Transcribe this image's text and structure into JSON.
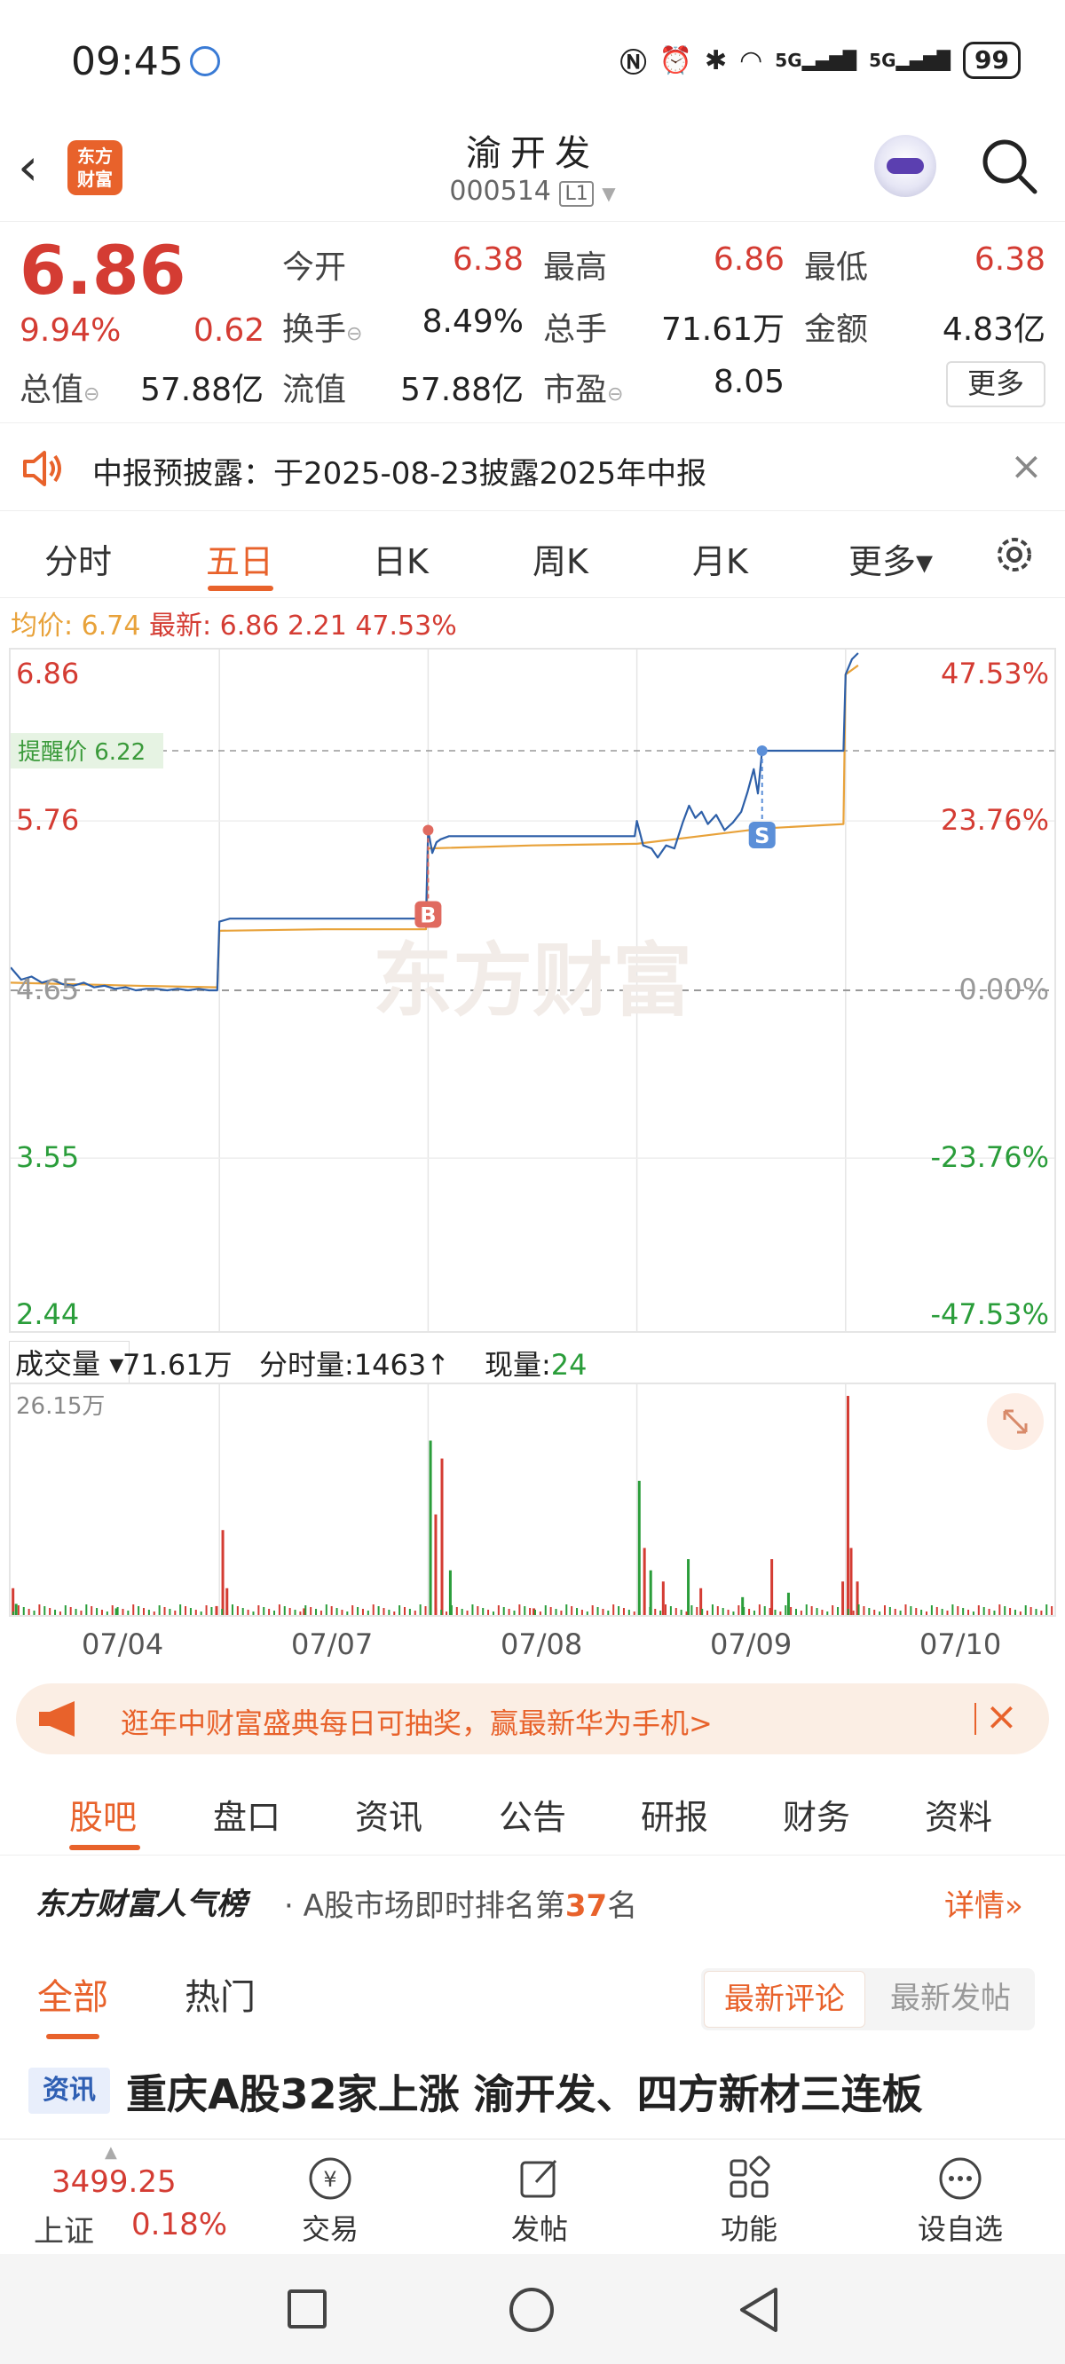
{
  "status_bar": {
    "time": "09:45",
    "network_1": "5G",
    "network_2": "5G",
    "battery": "99"
  },
  "header": {
    "stock_name": "渝开发",
    "stock_code": "000514",
    "level": "L1",
    "logo_line1": "东方",
    "logo_line2": "财富"
  },
  "quote": {
    "price": "6.86",
    "change_pct": "9.94%",
    "change": "0.62",
    "items": [
      {
        "label": "今开",
        "value": "6.38",
        "color": "#d43c33"
      },
      {
        "label": "最高",
        "value": "6.86",
        "color": "#d43c33"
      },
      {
        "label": "最低",
        "value": "6.38",
        "color": "#d43c33"
      },
      {
        "label": "换手",
        "value": "8.49%",
        "color": "#222222"
      },
      {
        "label": "总手",
        "value": "71.61万",
        "color": "#222222"
      },
      {
        "label": "金额",
        "value": "4.83亿",
        "color": "#222222"
      },
      {
        "label": "流值",
        "value": "57.88亿",
        "color": "#222222"
      },
      {
        "label": "市盈",
        "value": "8.05",
        "color": "#222222"
      }
    ],
    "total_value_label": "总值",
    "total_value": "57.88亿",
    "more_label": "更多"
  },
  "notice": {
    "text": "中报预披露：于2025-08-23披露2025年中报"
  },
  "chart_tabs": [
    "分时",
    "五日",
    "日K",
    "周K",
    "月K",
    "更多▾"
  ],
  "info_line": {
    "avg_label": "均价:",
    "avg_value": "6.74",
    "latest_label": "最新:",
    "latest_value": "6.86",
    "change": "2.21",
    "change_pct": "47.53%"
  },
  "chart_data": {
    "type": "line",
    "title": "",
    "x": [
      "07/04",
      "07/07",
      "07/08",
      "07/09",
      "07/10"
    ],
    "ylim": [
      2.44,
      6.86
    ],
    "y_ticks_left": [
      "6.86",
      "5.76",
      "4.65",
      "3.55",
      "2.44"
    ],
    "y_ticks_right": [
      "47.53%",
      "23.76%",
      "0.00%",
      "-23.76%",
      "-47.53%"
    ],
    "reference_price": 4.65,
    "alert_label": "提醒价 6.22",
    "alert_price": 6.22,
    "watermark": "东方财富",
    "series": [
      {
        "name": "最新",
        "color": "#2d5fa8",
        "values": [
          [
            0.0,
            4.8
          ],
          [
            0.05,
            4.72
          ],
          [
            0.1,
            4.74
          ],
          [
            0.15,
            4.7
          ],
          [
            0.2,
            4.72
          ],
          [
            0.25,
            4.69
          ],
          [
            0.3,
            4.68
          ],
          [
            0.35,
            4.7
          ],
          [
            0.4,
            4.67
          ],
          [
            0.45,
            4.68
          ],
          [
            0.5,
            4.66
          ],
          [
            0.55,
            4.67
          ],
          [
            0.6,
            4.65
          ],
          [
            0.65,
            4.66
          ],
          [
            0.7,
            4.66
          ],
          [
            0.75,
            4.65
          ],
          [
            0.8,
            4.66
          ],
          [
            0.85,
            4.65
          ],
          [
            0.9,
            4.66
          ],
          [
            0.95,
            4.65
          ],
          [
            0.99,
            4.65
          ],
          [
            1.0,
            5.1
          ],
          [
            1.05,
            5.12
          ],
          [
            1.3,
            5.12
          ],
          [
            1.6,
            5.12
          ],
          [
            1.99,
            5.12
          ],
          [
            2.0,
            5.7
          ],
          [
            2.02,
            5.55
          ],
          [
            2.04,
            5.62
          ],
          [
            2.06,
            5.64
          ],
          [
            2.1,
            5.66
          ],
          [
            2.3,
            5.66
          ],
          [
            2.6,
            5.66
          ],
          [
            2.99,
            5.66
          ],
          [
            3.0,
            5.76
          ],
          [
            3.03,
            5.6
          ],
          [
            3.07,
            5.58
          ],
          [
            3.1,
            5.52
          ],
          [
            3.14,
            5.6
          ],
          [
            3.18,
            5.58
          ],
          [
            3.22,
            5.75
          ],
          [
            3.25,
            5.86
          ],
          [
            3.28,
            5.78
          ],
          [
            3.31,
            5.82
          ],
          [
            3.34,
            5.74
          ],
          [
            3.38,
            5.8
          ],
          [
            3.42,
            5.7
          ],
          [
            3.46,
            5.75
          ],
          [
            3.5,
            5.82
          ],
          [
            3.53,
            5.95
          ],
          [
            3.56,
            6.1
          ],
          [
            3.58,
            5.94
          ],
          [
            3.6,
            6.22
          ],
          [
            3.62,
            6.22
          ],
          [
            3.7,
            6.22
          ],
          [
            3.8,
            6.22
          ],
          [
            3.99,
            6.22
          ],
          [
            4.0,
            6.72
          ],
          [
            4.03,
            6.82
          ],
          [
            4.06,
            6.86
          ]
        ]
      },
      {
        "name": "均价",
        "color": "#e8a23a",
        "values": [
          [
            0.0,
            4.7
          ],
          [
            0.3,
            4.69
          ],
          [
            0.6,
            4.68
          ],
          [
            0.99,
            4.67
          ],
          [
            1.0,
            5.04
          ],
          [
            1.5,
            5.05
          ],
          [
            1.99,
            5.05
          ],
          [
            2.0,
            5.58
          ],
          [
            2.5,
            5.6
          ],
          [
            2.99,
            5.61
          ],
          [
            3.0,
            5.61
          ],
          [
            3.3,
            5.66
          ],
          [
            3.6,
            5.71
          ],
          [
            3.99,
            5.74
          ],
          [
            4.0,
            6.72
          ],
          [
            4.06,
            6.78
          ]
        ]
      }
    ],
    "markers": [
      {
        "label": "B",
        "x": 2.0,
        "y": 5.7,
        "color": "#e06a60"
      },
      {
        "label": "S",
        "x": 3.6,
        "y": 6.22,
        "color": "#5b8fd8"
      }
    ]
  },
  "volume": {
    "label": "成交量",
    "total": "71.61万",
    "tick_label": "分时量:",
    "tick_value": "1463",
    "now_label": "现量:",
    "now_value": "24",
    "max_label": "26.15万"
  },
  "banner": {
    "text": "逛年中财富盛典每日可抽奖，赢最新华为手机>"
  },
  "sub_tabs": [
    "股吧",
    "盘口",
    "资讯",
    "公告",
    "研报",
    "财务",
    "资料"
  ],
  "ranking": {
    "title": "东方财富人气榜",
    "text_prefix": "· A股市场即时排名第",
    "rank": "37",
    "text_suffix": "名",
    "detail": "详情»"
  },
  "filter": {
    "all": "全部",
    "hot": "热门",
    "sort_new": "最新评论",
    "sort_post": "最新发帖"
  },
  "news": {
    "tag": "资讯",
    "title": "重庆A股32家上涨 渝开发、四方新材三连板"
  },
  "bottom_bar": {
    "index_value": "3499.25",
    "index_name": "上证",
    "index_pct": "0.18%",
    "items": [
      "交易",
      "发帖",
      "功能",
      "设自选"
    ]
  }
}
